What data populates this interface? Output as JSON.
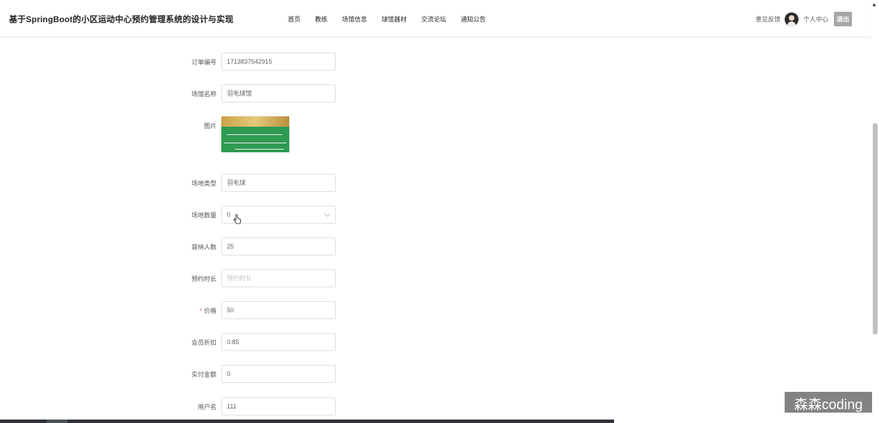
{
  "header": {
    "title": "基于SpringBoot的小区运动中心预约管理系统的设计与实现",
    "nav": [
      "首页",
      "教练",
      "场馆信息",
      "球馆器材",
      "交流论坛",
      "通知公告"
    ],
    "feedback_label": "意见反馈",
    "personal_label": "个人中心",
    "logout_label": "退出"
  },
  "form": {
    "order_no": {
      "label": "订单编号",
      "value": "1713837542915"
    },
    "venue_name": {
      "label": "场馆名称",
      "value": "羽毛球馆"
    },
    "image": {
      "label": "图片"
    },
    "venue_type": {
      "label": "场地类型",
      "value": "羽毛球"
    },
    "venue_count": {
      "label": "场地数量",
      "value": "0"
    },
    "capacity": {
      "label": "容纳人数",
      "value": "25"
    },
    "duration": {
      "label": "预约时长",
      "placeholder": "预约时长"
    },
    "price": {
      "label": "价格",
      "required_mark": "*",
      "value": "50"
    },
    "member_discount": {
      "label": "会员折扣",
      "value": "0.85"
    },
    "actual_amount": {
      "label": "实付金额",
      "value": "0"
    },
    "username": {
      "label": "用户名",
      "value": "111"
    }
  },
  "watermark": "森森coding"
}
